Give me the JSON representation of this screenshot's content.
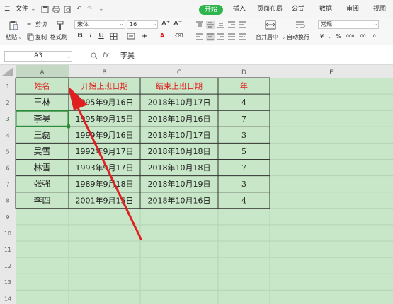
{
  "menubar": {
    "file_label": "文件",
    "tabs": [
      "开始",
      "插入",
      "页面布局",
      "公式",
      "数据",
      "审阅",
      "视图"
    ]
  },
  "ribbon": {
    "paste_label": "粘贴",
    "cut_label": "剪切",
    "copy_label": "复制",
    "format_painter_label": "格式刷",
    "font_name": "宋体",
    "font_size": "16",
    "merge_center_label": "合并居中",
    "wrap_text_label": "自动换行",
    "number_format": "常规"
  },
  "formula_bar": {
    "cell_ref": "A3",
    "fx_label": "fx",
    "content": "李昊"
  },
  "sheet": {
    "columns": [
      "A",
      "B",
      "C",
      "D",
      "E"
    ],
    "rows": [
      "1",
      "2",
      "3",
      "4",
      "5",
      "6",
      "7",
      "8",
      "9",
      "10",
      "11",
      "12",
      "13",
      "14"
    ],
    "header": [
      "姓名",
      "开始上班日期",
      "结束上班日期",
      "年"
    ],
    "data": [
      [
        "王林",
        "1995年9月16日",
        "2018年10月17日",
        "4"
      ],
      [
        "李昊",
        "1995年9月15日",
        "2018年10月16日",
        "7"
      ],
      [
        "王磊",
        "1999年9月16日",
        "2018年10月17日",
        "3"
      ],
      [
        "吴雪",
        "1992年9月17日",
        "2018年10月18日",
        "5"
      ],
      [
        "林雪",
        "1993年9月17日",
        "2018年10月18日",
        "7"
      ],
      [
        "张强",
        "1989年9月18日",
        "2018年10月19日",
        "3"
      ],
      [
        "李四",
        "2001年9月15日",
        "2018年10月16日",
        "4"
      ]
    ],
    "header_color": "#e02020",
    "selected_cell": "A3"
  },
  "colors": {
    "grid_background": "#c8e6c8",
    "accent": "#2fb54e",
    "arrow": "#e02020",
    "selection": "#2e8b3a"
  }
}
